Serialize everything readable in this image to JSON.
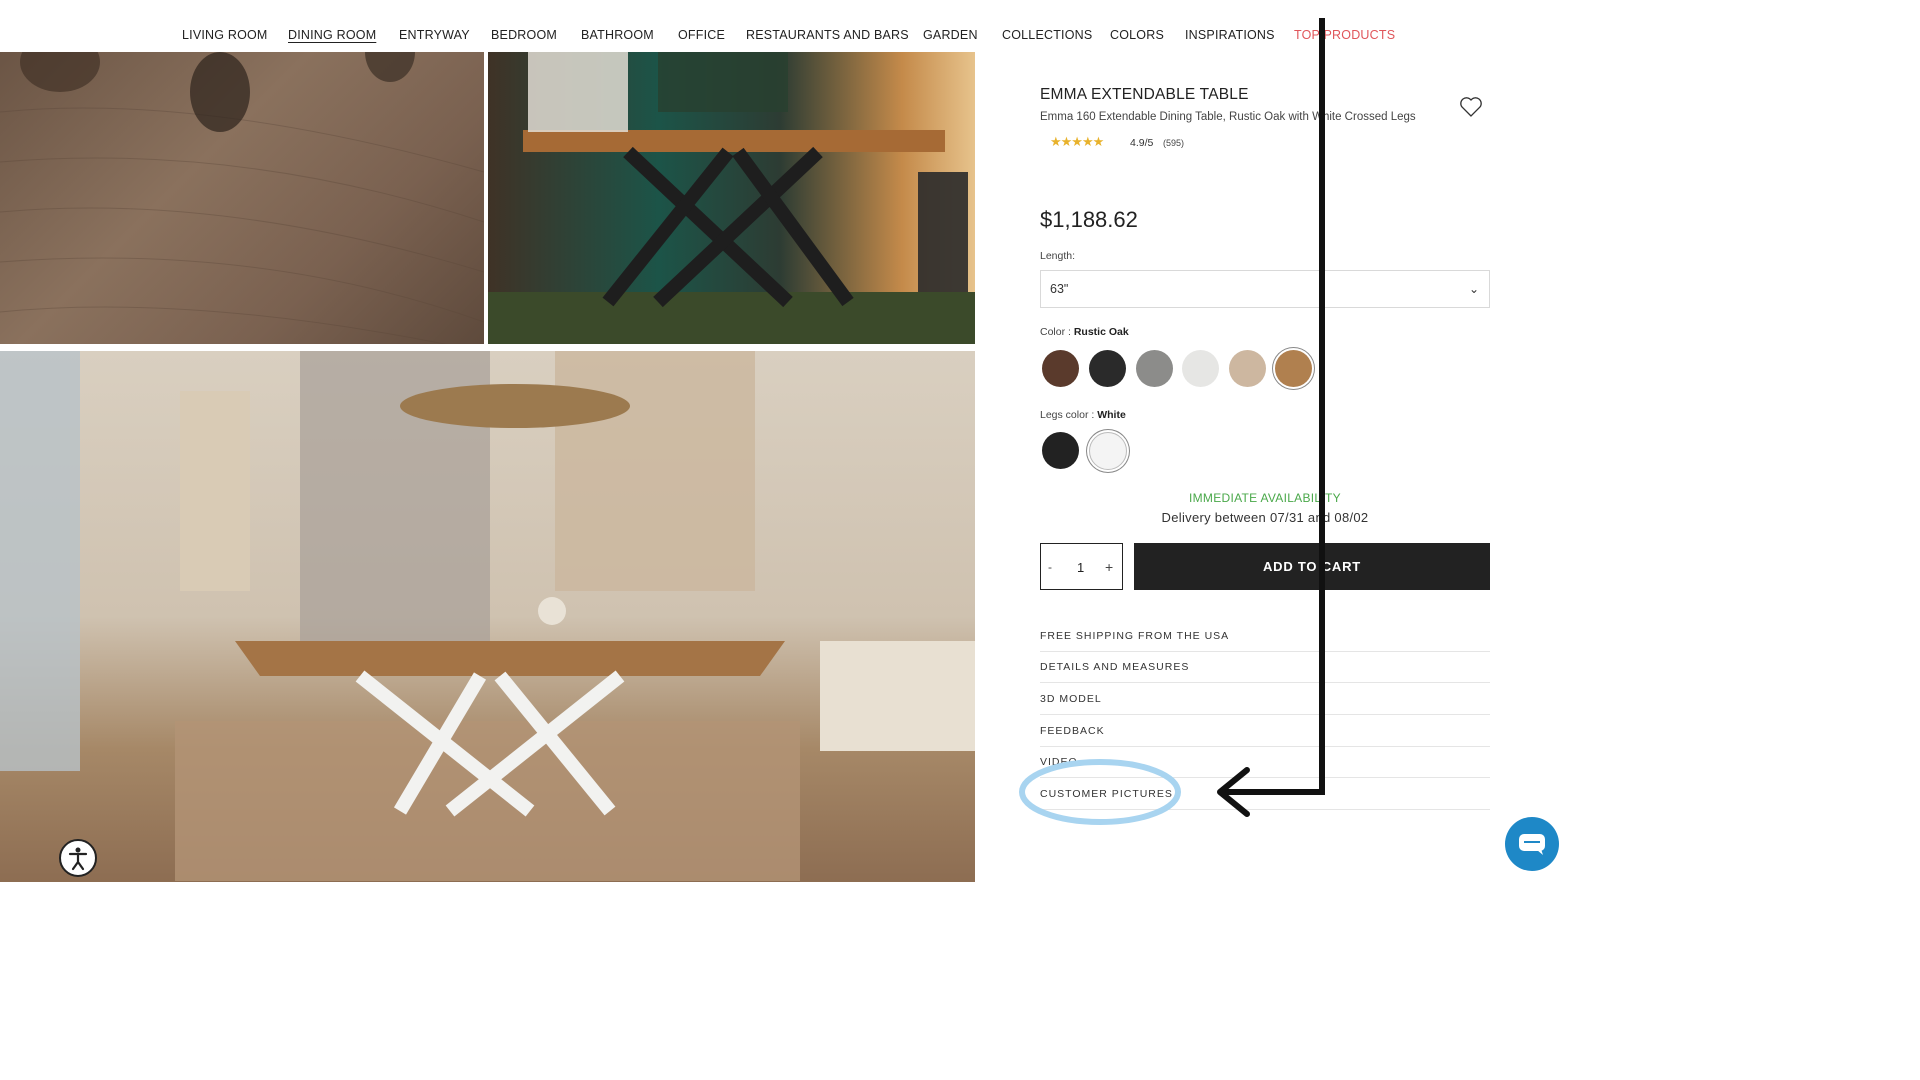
{
  "nav": {
    "items": [
      "LIVING ROOM",
      "DINING ROOM",
      "ENTRYWAY",
      "BEDROOM",
      "BATHROOM",
      "OFFICE",
      "RESTAURANTS AND BARS",
      "GARDEN",
      "COLLECTIONS",
      "COLORS",
      "INSPIRATIONS",
      "TOP PRODUCTS"
    ],
    "active": "DINING ROOM",
    "highlight": "TOP PRODUCTS",
    "highlight_color": "#e0565b"
  },
  "product": {
    "title": "EMMA EXTENDABLE TABLE",
    "subtitle": "Emma 160 Extendable Dining Table, Rustic Oak with White Crossed Legs",
    "stars": "★★★★★",
    "rating": "4.9/5",
    "reviews": "(595)",
    "price": "$1,188.62"
  },
  "options": {
    "length_label": "Length:",
    "length_value": "63\"",
    "color_label": "Color : ",
    "color_value": "Rustic Oak",
    "color_swatches": [
      "#5a3a2c",
      "#2a2a2a",
      "#8c8c8a",
      "#e6e6e4",
      "#cdb7a0",
      "#b0804f"
    ],
    "legs_label": "Legs color : ",
    "legs_value": "White",
    "legs_swatches": [
      "#222222",
      "#f4f4f4"
    ]
  },
  "availability": {
    "status": "IMMEDIATE AVAILABILITY",
    "delivery": "Delivery between 07/31 and 08/02",
    "status_color": "#4aa84a"
  },
  "cart": {
    "minus": "-",
    "qty": "1",
    "plus": "+",
    "add_label": "ADD TO CART"
  },
  "accordion": [
    "FREE SHIPPING FROM THE USA",
    "DETAILS AND MEASURES",
    "3D MODEL",
    "FEEDBACK",
    "VIDEO",
    "CUSTOMER PICTURES"
  ],
  "annotation": {
    "highlight_color": "#a8d4f0",
    "arrow_color": "#111111",
    "target": "CUSTOMER PICTURES"
  },
  "icons": [
    "heart-icon",
    "chevron-down-icon",
    "accessibility-icon",
    "chat-icon"
  ]
}
